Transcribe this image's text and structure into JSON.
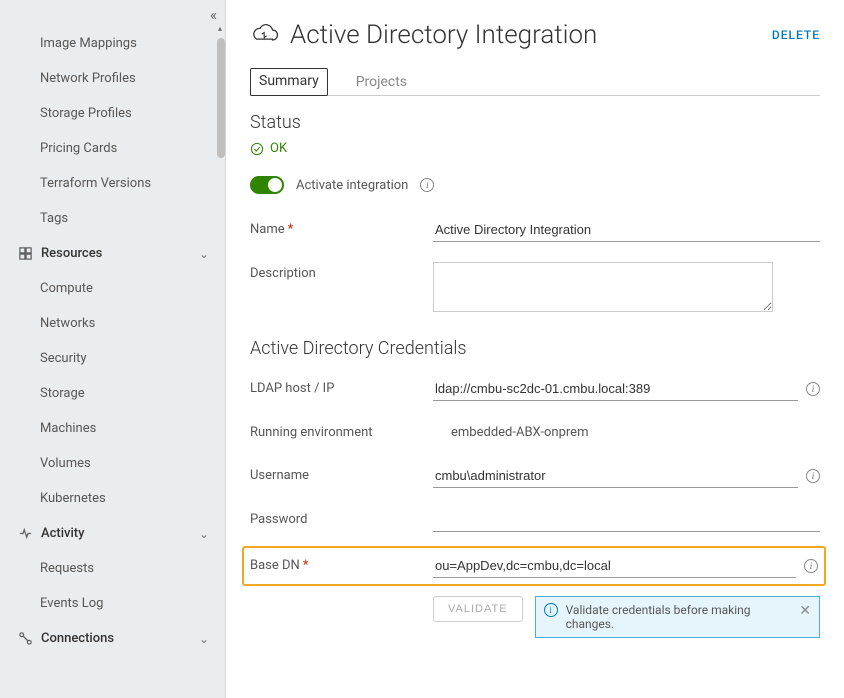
{
  "sidebar": {
    "simple_items_top": [
      "Image Mappings",
      "Network Profiles",
      "Storage Profiles",
      "Pricing Cards",
      "Terraform Versions",
      "Tags"
    ],
    "groups": [
      {
        "id": "resources",
        "label": "Resources",
        "icon": "resources-icon",
        "items": [
          "Compute",
          "Networks",
          "Security",
          "Storage",
          "Machines",
          "Volumes",
          "Kubernetes"
        ]
      },
      {
        "id": "activity",
        "label": "Activity",
        "icon": "activity-icon",
        "items": [
          "Requests",
          "Events Log"
        ]
      },
      {
        "id": "connections",
        "label": "Connections",
        "icon": "connections-icon",
        "items": []
      }
    ]
  },
  "page": {
    "title": "Active Directory Integration",
    "delete_label": "DELETE",
    "tabs": [
      {
        "label": "Summary",
        "active": true
      },
      {
        "label": "Projects",
        "active": false
      }
    ],
    "status": {
      "heading": "Status",
      "text": "OK"
    },
    "toggle": {
      "label": "Activate integration",
      "on": true
    },
    "form": {
      "name_label": "Name",
      "name_value": "Active Directory Integration",
      "description_label": "Description",
      "description_value": ""
    },
    "credentials": {
      "heading": "Active Directory Credentials",
      "ldap_label": "LDAP host / IP",
      "ldap_value": "ldap://cmbu-sc2dc-01.cmbu.local:389",
      "runenv_label": "Running environment",
      "runenv_value": "embedded-ABX-onprem",
      "username_label": "Username",
      "username_value": "cmbu\\administrator",
      "password_label": "Password",
      "password_value": "",
      "basedn_label": "Base DN",
      "basedn_value": "ou=AppDev,dc=cmbu,dc=local"
    },
    "validate": {
      "button_label": "VALIDATE",
      "notice_text": "Validate credentials before making changes."
    }
  }
}
